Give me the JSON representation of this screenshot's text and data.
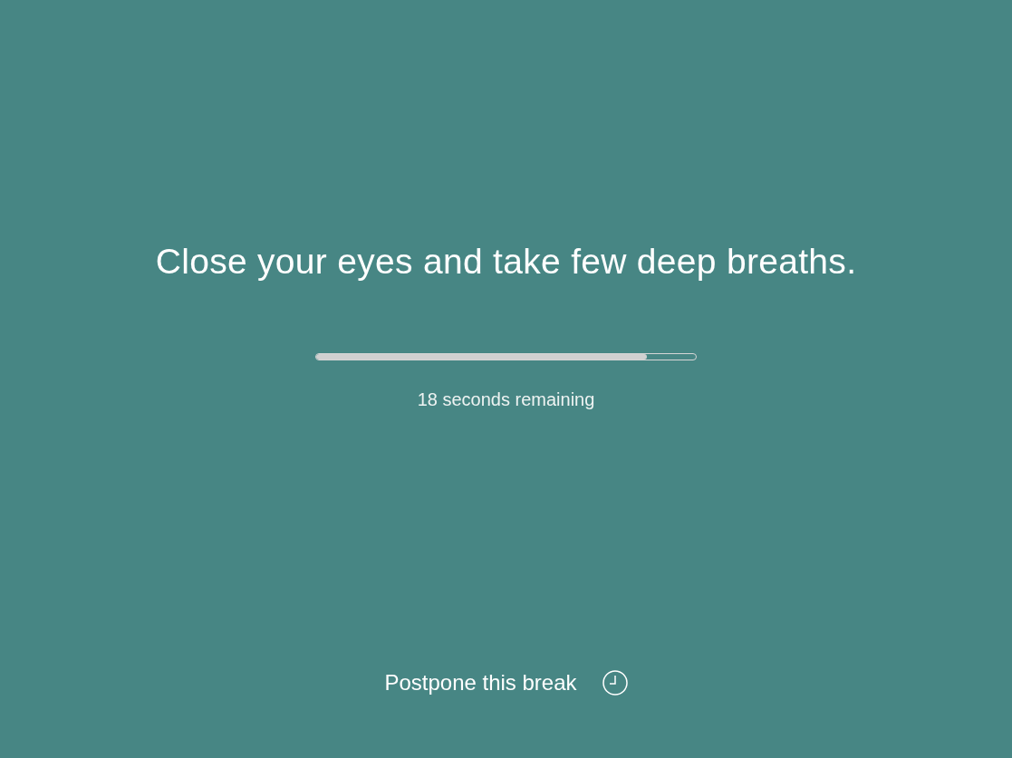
{
  "message": "Close your eyes and take few deep breaths.",
  "progress": {
    "level": 0.87
  },
  "remaining": "18 seconds remaining",
  "postpone_button": {
    "label": "Postpone this break"
  }
}
